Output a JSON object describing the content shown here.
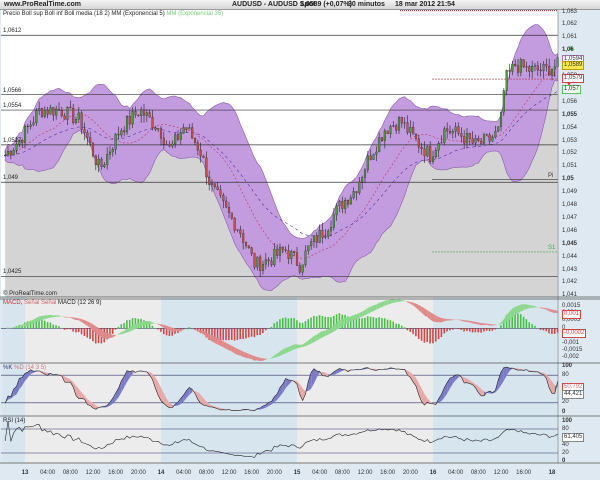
{
  "header": {
    "site": "www.ProRealTime.com",
    "instrument": "AUDUSD - AUDUSD Spot",
    "quote": "1,0589 (+0,07%)",
    "interval": "30 minutos",
    "datetime": "18 mar 2012 21:54"
  },
  "main_legend": {
    "part1": "Precio Boll sup Boll inf Boll media (18 2) MM (Exponencial 5)",
    "part2": "MM (Exponencial 35)"
  },
  "footer_logo": "© ProRealTime.com",
  "level_lines": [
    {
      "label": "1,0612",
      "price": 1.0612
    },
    {
      "label": "1,0566",
      "price": 1.0566
    },
    {
      "label": "1,0554",
      "price": 1.0554
    },
    {
      "label": "1,0527",
      "price": 1.0527
    },
    {
      "label": "1,049",
      "price": 1.0498
    },
    {
      "label": "1,0425",
      "price": 1.0425
    }
  ],
  "pivots": [
    {
      "label": "R1",
      "price": 1.0578
    },
    {
      "label": "Pi",
      "price": 1.05
    },
    {
      "label": "S1",
      "price": 1.0444
    }
  ],
  "price_axis": [
    "1,063",
    "1,062",
    "1,061",
    "1,06",
    "1,059",
    "1,058",
    "1,057",
    "1,056",
    "1,055",
    "1,054",
    "1,053",
    "1,052",
    "1,051",
    "1,05",
    "1,049",
    "1,048",
    "1,047",
    "1,046",
    "1,045",
    "1,044",
    "1,043",
    "1,042",
    "1,041"
  ],
  "price_tags": {
    "upper": "1,0594",
    "last": "1,0589",
    "lower": "1,0579",
    "green": "1,057"
  },
  "macd": {
    "title_a": "MACD",
    "title_b": "Señal Señal",
    "title_c": "MACD (12 26 9)",
    "axis": [
      "0,0015",
      "0,001",
      "0,0005",
      "0",
      "-0,0005",
      "-0,001",
      "-0,0015",
      "-0,002"
    ],
    "tag1": "0,001",
    "tag2": "-0,0002"
  },
  "stoch": {
    "title_a": "%K",
    "title_b": "%D (14 3 5)",
    "axis": [
      "100",
      "80",
      "20",
      "0"
    ],
    "tag1": "50,792",
    "tag2": "44,421"
  },
  "rsi": {
    "title": "RSI (14)",
    "axis": [
      "100",
      "80",
      "40",
      "20",
      "0"
    ],
    "tag": "61,405"
  },
  "x_axis": [
    {
      "h": 0,
      "t": "13",
      "d": 1
    },
    {
      "h": 4,
      "t": "04:00"
    },
    {
      "h": 8,
      "t": "08:00"
    },
    {
      "h": 12,
      "t": "12:00"
    },
    {
      "h": 16,
      "t": "16:00"
    },
    {
      "h": 20,
      "t": "20:00"
    },
    {
      "h": 24,
      "t": "14",
      "d": 1
    },
    {
      "h": 28,
      "t": "04:00"
    },
    {
      "h": 32,
      "t": "08:00"
    },
    {
      "h": 36,
      "t": "12:00"
    },
    {
      "h": 40,
      "t": "16:00"
    },
    {
      "h": 44,
      "t": "20:00"
    },
    {
      "h": 48,
      "t": "15",
      "d": 1
    },
    {
      "h": 52,
      "t": "04:00"
    },
    {
      "h": 56,
      "t": "08:00"
    },
    {
      "h": 60,
      "t": "12:00"
    },
    {
      "h": 64,
      "t": "16:00"
    },
    {
      "h": 68,
      "t": "20:00"
    },
    {
      "h": 72,
      "t": "16",
      "d": 1
    },
    {
      "h": 76,
      "t": "04:00"
    },
    {
      "h": 80,
      "t": "08:00"
    },
    {
      "h": 84,
      "t": "12:00"
    },
    {
      "h": 88,
      "t": "16:00"
    },
    {
      "h": 93,
      "t": "18",
      "d": 1
    }
  ],
  "chart_data": {
    "type": "candlestick",
    "title": "AUDUSD - AUDUSD Spot 30 minutos",
    "x_unit": "hours since 13 Mar 2012 00:00",
    "ylim": [
      1.041,
      1.063
    ],
    "close_anchors": [
      [
        -3.5,
        1.0519
      ],
      [
        -0.9,
        1.0531
      ],
      [
        2.6,
        1.0554
      ],
      [
        6.2,
        1.0554
      ],
      [
        9.7,
        1.0546
      ],
      [
        13.2,
        1.0508
      ],
      [
        16.8,
        1.0539
      ],
      [
        20.3,
        1.0554
      ],
      [
        23.8,
        1.0539
      ],
      [
        25.6,
        1.0523
      ],
      [
        28.2,
        1.0542
      ],
      [
        30.9,
        1.0523
      ],
      [
        32.7,
        1.0496
      ],
      [
        35.3,
        1.0477
      ],
      [
        37.9,
        1.0461
      ],
      [
        40.6,
        1.0434
      ],
      [
        43.2,
        1.0438
      ],
      [
        45.9,
        1.0446
      ],
      [
        48.5,
        1.0434
      ],
      [
        50.3,
        1.0449
      ],
      [
        52.9,
        1.0461
      ],
      [
        55.6,
        1.048
      ],
      [
        58.2,
        1.0492
      ],
      [
        60.9,
        1.0519
      ],
      [
        63.5,
        1.0539
      ],
      [
        66.2,
        1.0546
      ],
      [
        68.8,
        1.0531
      ],
      [
        71.5,
        1.0519
      ],
      [
        74.1,
        1.0539
      ],
      [
        76.8,
        1.0535
      ],
      [
        79.4,
        1.0527
      ],
      [
        82.1,
        1.0531
      ],
      [
        83.8,
        1.0539
      ],
      [
        84.7,
        1.0577
      ],
      [
        86.5,
        1.0589
      ],
      [
        89.1,
        1.0585
      ],
      [
        91.8,
        1.0585
      ],
      [
        94.1,
        1.0589
      ]
    ],
    "indicators": [
      "Bollinger (18 2)",
      "EMA 5",
      "EMA 35",
      "MACD (12 26 9)",
      "Stochastic %K %D (14 3 5)",
      "RSI (14)"
    ]
  }
}
